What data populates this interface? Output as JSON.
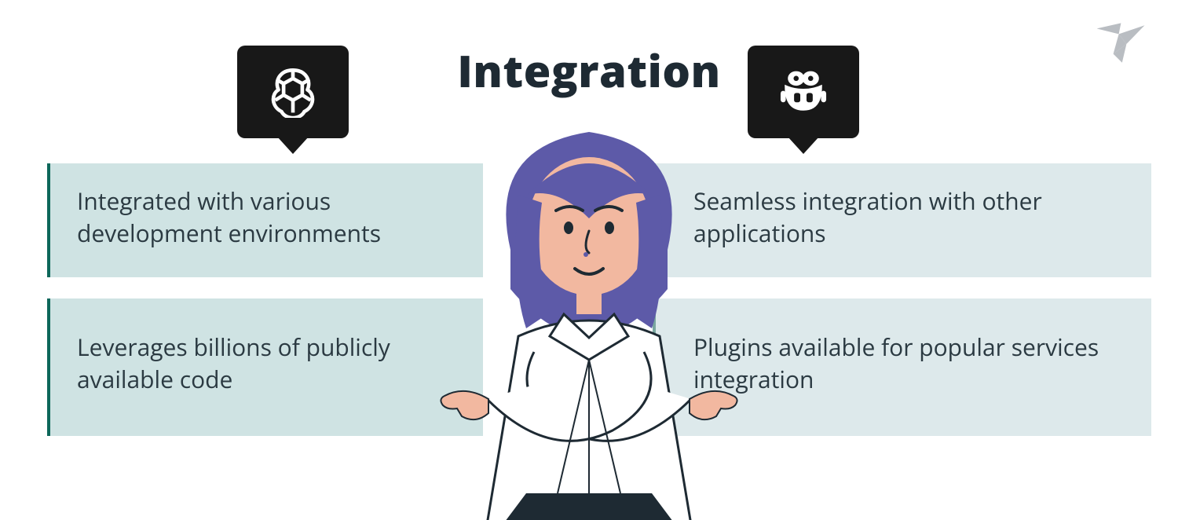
{
  "title": "Integration",
  "left_icon": "openai-knot-icon",
  "right_icon": "copilot-robot-icon",
  "cards": {
    "left": [
      "Integrated with various development environments",
      "Leverages billions of publicly available code"
    ],
    "right": [
      "Seamless integration with other applications",
      "Plugins available for popular services integration"
    ]
  },
  "colors": {
    "title": "#1e2a33",
    "card_left_bg": "#cfe3e3",
    "card_left_border": "#0d675a",
    "card_right_bg": "#dde9eb",
    "card_right_border": "#7aa7a0",
    "bubble_bg": "#181818",
    "person_hair": "#5d5aa8",
    "person_skin": "#f2b8a0",
    "bird_logo": "#b9bdc2"
  },
  "logo": "freelancer-bird"
}
